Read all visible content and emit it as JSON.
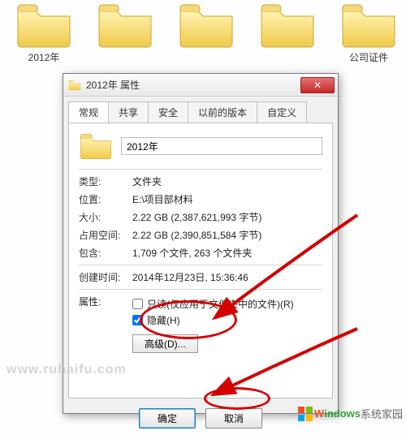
{
  "desktop": {
    "items": [
      {
        "label": "2012年"
      },
      {
        "label": ""
      },
      {
        "label": ""
      },
      {
        "label": ""
      },
      {
        "label": "公司证件"
      }
    ]
  },
  "dialog": {
    "title": "2012年 属性",
    "tabs": [
      {
        "label": "常规"
      },
      {
        "label": "共享"
      },
      {
        "label": "安全"
      },
      {
        "label": "以前的版本"
      },
      {
        "label": "自定义"
      }
    ],
    "folder_name": "2012年",
    "rows": {
      "type_k": "类型:",
      "type_v": "文件夹",
      "loc_k": "位置:",
      "loc_v": "E:\\项目部材料",
      "size_k": "大小:",
      "size_v": "2.22 GB (2,387,621,993 字节)",
      "disk_k": "占用空间:",
      "disk_v": "2.22 GB (2,390,851,584 字节)",
      "contains_k": "包含:",
      "contains_v": "1,709 个文件, 263 个文件夹",
      "created_k": "创建时间:",
      "created_v": "2014年12月23日, 15:36:46"
    },
    "attrs": {
      "label": "属性:",
      "readonly": "只读(仅应用于文件夹中的文件)(R)",
      "hidden": "隐藏(H)",
      "advanced": "高级(D)..."
    },
    "buttons": {
      "ok": "确定",
      "cancel": "取消"
    }
  },
  "watermarks": {
    "w1": "www.ruhaifu.com",
    "w2a": "indows",
    "w2b": "系统家园"
  }
}
